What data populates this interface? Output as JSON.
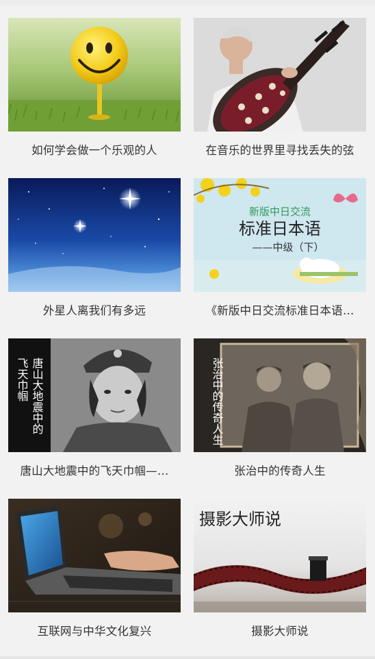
{
  "items": [
    {
      "title": "如何学会做一个乐观的人",
      "image": "smiley-golf-ball"
    },
    {
      "title": "在音乐的世界里寻找丢失的弦",
      "image": "pipa-player"
    },
    {
      "title": "外星人离我们有多远",
      "image": "starry-sky"
    },
    {
      "title": "《新版中日交流标准日本语…",
      "image": "japanese-textbook",
      "cover": {
        "line1": "新版中日交流",
        "line2": "标准日本语",
        "line3": "——中级（下）"
      }
    },
    {
      "title": "唐山大地震中的飞天巾帼—…",
      "image": "female-soldier-portrait",
      "overlay": {
        "col1": "唐山大地震中的",
        "col2": "飞天巾帼"
      }
    },
    {
      "title": "张治中的传奇人生",
      "image": "historical-photo",
      "overlay": {
        "col1": "张治中的传奇人生"
      }
    },
    {
      "title": "互联网与中华文化复兴",
      "image": "laptop-typing"
    },
    {
      "title": "摄影大师说",
      "image": "film-reel",
      "overlay": {
        "text": "摄影大师说"
      }
    }
  ]
}
